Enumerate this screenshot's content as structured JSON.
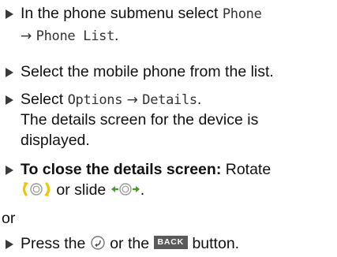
{
  "steps": {
    "s1": {
      "prefix": "In the phone submenu select ",
      "menu1": "Phone",
      "arrow": "→",
      "menu2": "Phone List",
      "suffix": "."
    },
    "s2": {
      "text": "Select the mobile phone from the list."
    },
    "s3": {
      "prefix": "Select ",
      "menu1": "Options",
      "arrow": "→",
      "menu2": "Details",
      "suffix": ".",
      "result_line1": "The details screen for the device is",
      "result_line2": "displayed."
    },
    "s4": {
      "bold": "To close the details screen:",
      "text1": " Rotate",
      "text2": " or slide ",
      "suffix": "."
    },
    "or_text": "or",
    "s5": {
      "prefix": "Press the ",
      "middle": " or the ",
      "back_label": "BACK",
      "suffix": " button."
    }
  },
  "icons": {
    "bullet": "bullet-triangle-icon",
    "rotate": "rotate-controller-icon",
    "slide": "slide-controller-icon",
    "back_circle": "back-circle-icon"
  },
  "colors": {
    "text": "#111111",
    "bullet": "#3a3a3a",
    "rotate_accent": "#f5c400",
    "slide_accent": "#4a9a2a",
    "controller": "#9a9a9a",
    "back_key_bg": "#5a5a5a"
  }
}
